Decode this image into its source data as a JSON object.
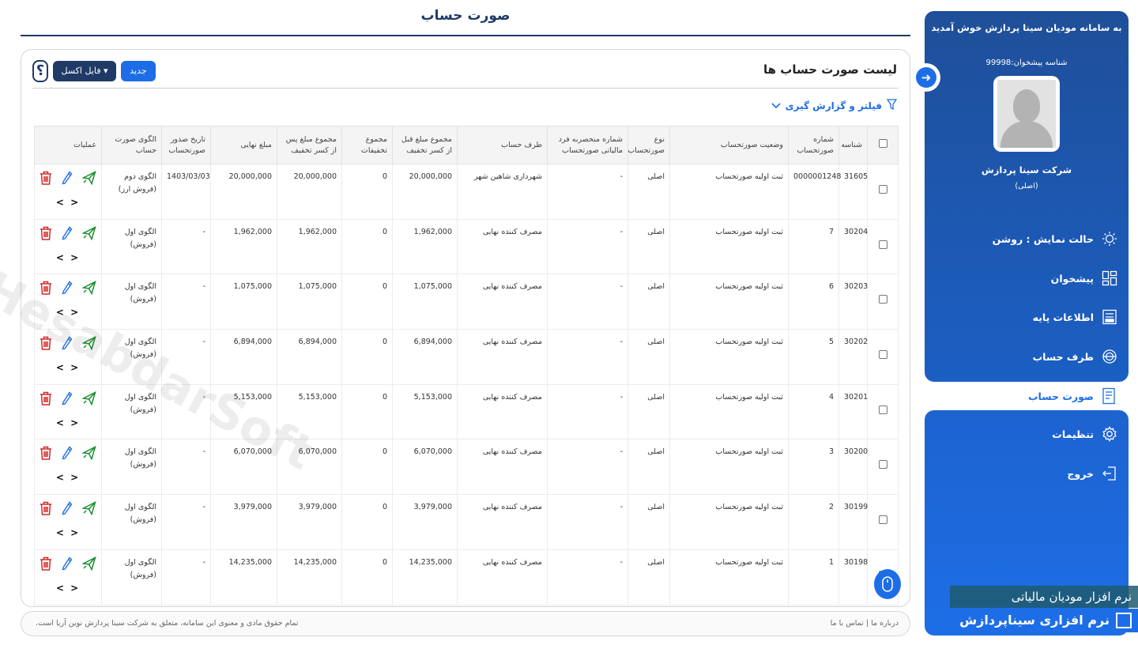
{
  "page": {
    "title": "صورت حساب"
  },
  "sidebar": {
    "welcome": "به سامانه مودیان سینا پردازش خوش آمدید",
    "taxpayer_id": "شناسه پیشخوان:99998",
    "company": "شرکت سینا پردازش",
    "role": "(اصلی)",
    "items": [
      {
        "label": "حالت نمایش    : روشن",
        "icon": "sun-icon"
      },
      {
        "label": "پیشخوان",
        "icon": "dashboard-icon"
      },
      {
        "label": "اطلاعات پایه",
        "icon": "document-icon"
      },
      {
        "label": "طرف حساب",
        "icon": "globe-icon"
      },
      {
        "label": "صورت حساب",
        "icon": "invoice-icon"
      },
      {
        "label": "تنظیمات",
        "icon": "gear-icon"
      },
      {
        "label": "خروج",
        "icon": "logout-icon"
      }
    ]
  },
  "list": {
    "title": "لیست صورت حساب ها",
    "new_label": "جدید",
    "excel_label": "فایل اکسل",
    "help_label": "؟",
    "filter_label": "فیلتر و گزارش گیری"
  },
  "table": {
    "headers": {
      "id": "شناسه",
      "number": "شماره صورتحساب",
      "status": "وضعیت صورتحساب",
      "type": "نوع صورتحساب",
      "tax_id": "شماره منحصربه فرد مالیاتی صورتحساب",
      "party": "طرف حساب",
      "before_discount": "مجموع مبلغ قبل از کسر تخفیف",
      "discounts": "مجموع تخفیفات",
      "after_discount": "مجموع مبلغ پس از کسر تخفیف",
      "final": "مبلغ نهایی",
      "issue_date": "تاریخ صدور صورتحساب",
      "pattern": "الگوی صورت حساب",
      "ops": "عملیات"
    },
    "rows": [
      {
        "id": "31605",
        "number": "0000001248",
        "status": "ثبت اولیه صورتحساب",
        "type": "اصلی",
        "tax_id": "-",
        "party": "شهرداری شاهین شهر",
        "before_discount": "20,000,000",
        "discounts": "0",
        "after_discount": "20,000,000",
        "final": "20,000,000",
        "issue_date": "1403/03/03",
        "pattern": "الگوی دوم (فروش ارز)"
      },
      {
        "id": "30204",
        "number": "7",
        "status": "ثبت اولیه صورتحساب",
        "type": "اصلی",
        "tax_id": "-",
        "party": "مصرف کننده نهایی",
        "before_discount": "1,962,000",
        "discounts": "0",
        "after_discount": "1,962,000",
        "final": "1,962,000",
        "issue_date": "-",
        "pattern": "الگوی اول (فروش)"
      },
      {
        "id": "30203",
        "number": "6",
        "status": "ثبت اولیه صورتحساب",
        "type": "اصلی",
        "tax_id": "-",
        "party": "مصرف کننده نهایی",
        "before_discount": "1,075,000",
        "discounts": "0",
        "after_discount": "1,075,000",
        "final": "1,075,000",
        "issue_date": "-",
        "pattern": "الگوی اول (فروش)"
      },
      {
        "id": "30202",
        "number": "5",
        "status": "ثبت اولیه صورتحساب",
        "type": "اصلی",
        "tax_id": "-",
        "party": "مصرف کننده نهایی",
        "before_discount": "6,894,000",
        "discounts": "0",
        "after_discount": "6,894,000",
        "final": "6,894,000",
        "issue_date": "-",
        "pattern": "الگوی اول (فروش)"
      },
      {
        "id": "30201",
        "number": "4",
        "status": "ثبت اولیه صورتحساب",
        "type": "اصلی",
        "tax_id": "-",
        "party": "مصرف کننده نهایی",
        "before_discount": "5,153,000",
        "discounts": "0",
        "after_discount": "5,153,000",
        "final": "5,153,000",
        "issue_date": "-",
        "pattern": "الگوی اول (فروش)"
      },
      {
        "id": "30200",
        "number": "3",
        "status": "ثبت اولیه صورتحساب",
        "type": "اصلی",
        "tax_id": "-",
        "party": "مصرف کننده نهایی",
        "before_discount": "6,070,000",
        "discounts": "0",
        "after_discount": "6,070,000",
        "final": "6,070,000",
        "issue_date": "-",
        "pattern": "الگوی اول (فروش)"
      },
      {
        "id": "30199",
        "number": "2",
        "status": "ثبت اولیه صورتحساب",
        "type": "اصلی",
        "tax_id": "-",
        "party": "مصرف کننده نهایی",
        "before_discount": "3,979,000",
        "discounts": "0",
        "after_discount": "3,979,000",
        "final": "3,979,000",
        "issue_date": "-",
        "pattern": "الگوی اول (فروش)"
      },
      {
        "id": "30198",
        "number": "1",
        "status": "ثبت اولیه صورتحساب",
        "type": "اصلی",
        "tax_id": "-",
        "party": "مصرف کننده نهایی",
        "before_discount": "14,235,000",
        "discounts": "0",
        "after_discount": "14,235,000",
        "final": "14,235,000",
        "issue_date": "-",
        "pattern": "الگوی اول (فروش)"
      }
    ],
    "nav_arrows": "< >"
  },
  "footer": {
    "links": "درباره ما | تماس با ما",
    "copyright": "تمام حقوق مادی و معنوی این سامانه، متعلق به شرکت سینا پردازش نوین آریا است."
  },
  "watermark": {
    "line1": "نرم افزار مودیان مالیاتی",
    "line2": "نرم افزاری سیناپردازش",
    "diagonal": "HesabdarSoft"
  },
  "colors": {
    "primary": "#1d6ee6",
    "navy": "#1f3a66",
    "send": "#1a8f2e",
    "delete": "#d62828"
  }
}
